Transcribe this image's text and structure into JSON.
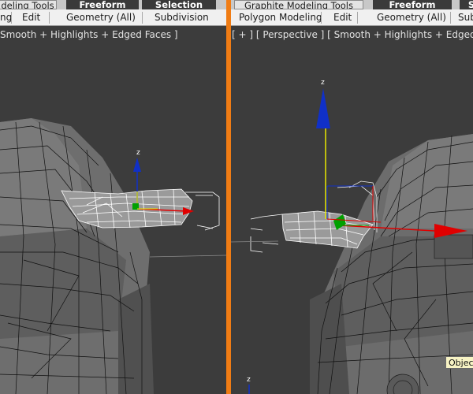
{
  "left": {
    "tabs": [
      "deling Tools",
      "Freeform",
      "Selection"
    ],
    "subtabs": [
      "ng",
      "Edit",
      "Geometry (All)",
      "Subdivision"
    ],
    "viewport_label": "Smooth + Highlights + Edged Faces ]",
    "axis_z": "z"
  },
  "right": {
    "tabs": [
      "Graphite Modeling Tools",
      "Freeform",
      "S"
    ],
    "subtabs": [
      "Polygon Modeling",
      "Edit",
      "Geometry (All)",
      "Sub"
    ],
    "viewport_label": "[ + ] [ Perspective ] [ Smooth + Highlights + Edged Faces ]",
    "axis_z_top": "z",
    "axis_z_bottom": "z",
    "tooltip": "Object"
  },
  "colors": {
    "accent_divider": "#f07c14",
    "viewport_bg": "#3c3c3c",
    "gizmo_x": "#e00000",
    "gizmo_y": "#00a000",
    "gizmo_z": "#1030c8",
    "gizmo_z_axis_highlight": "#e8e800"
  }
}
